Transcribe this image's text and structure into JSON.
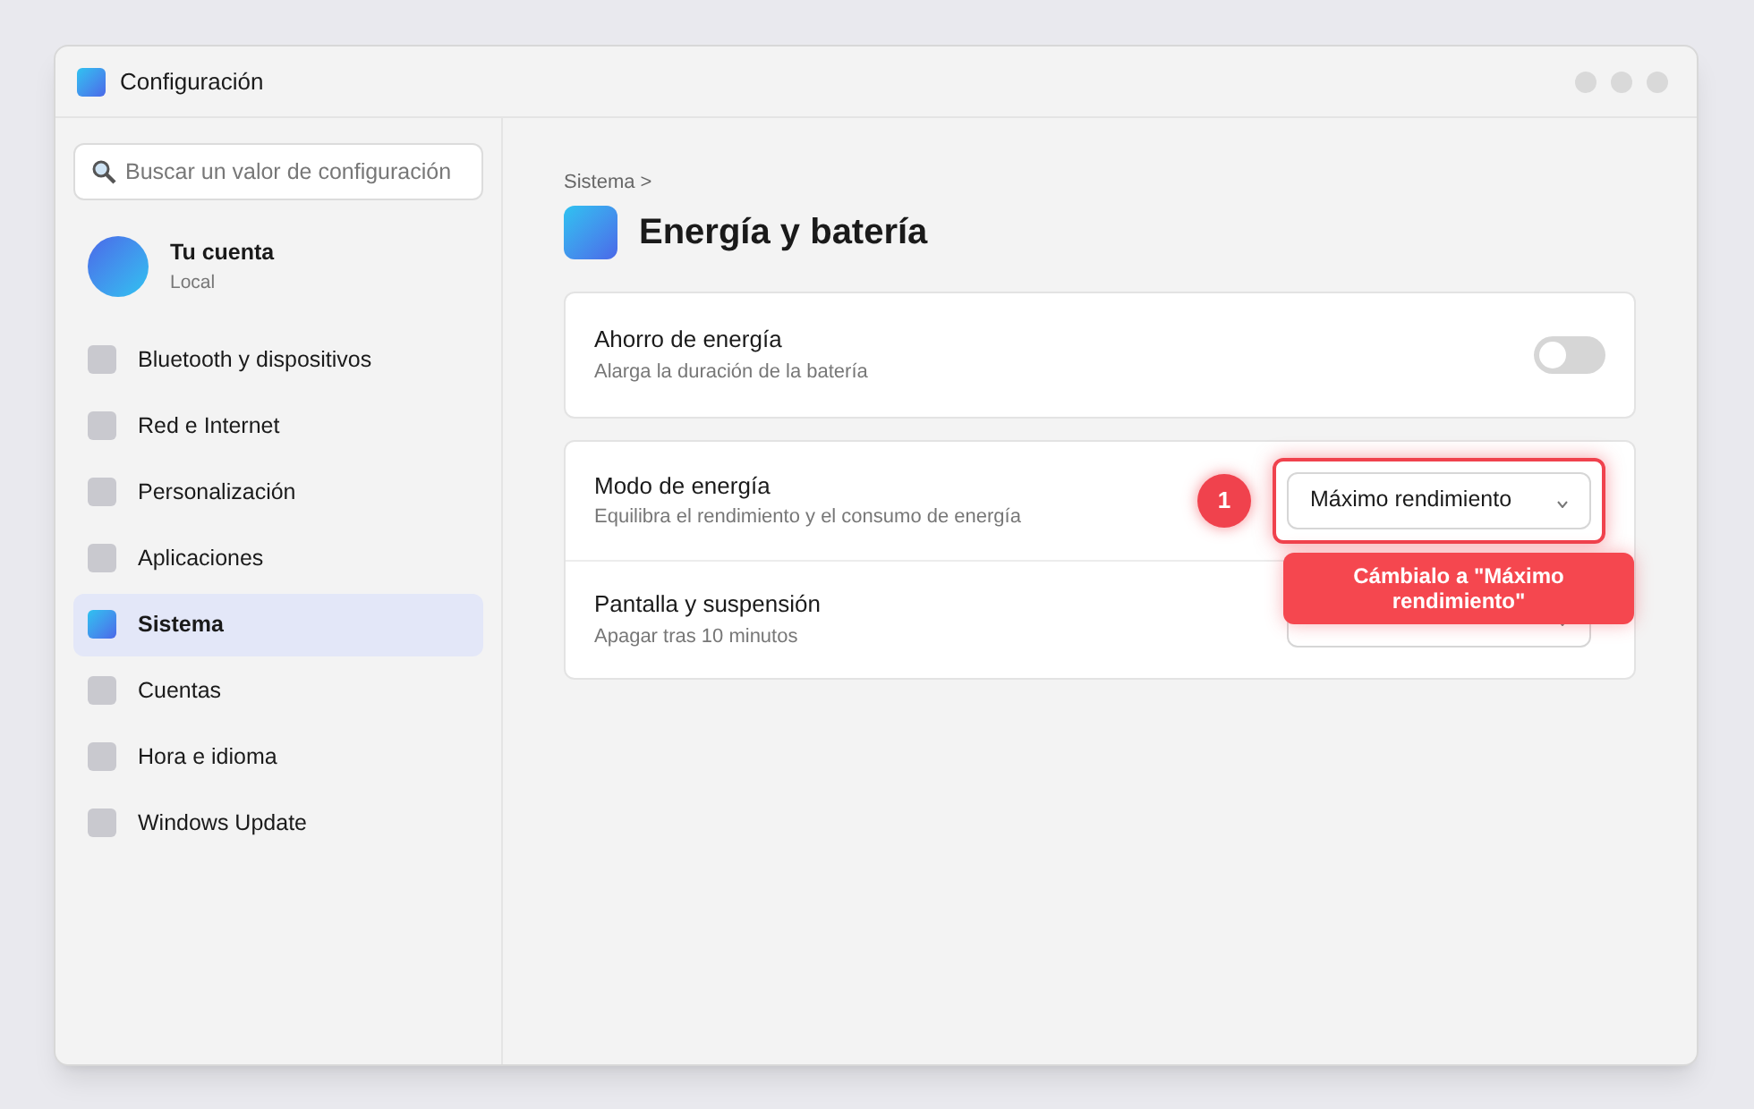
{
  "window": {
    "title": "Configuración"
  },
  "search": {
    "placeholder": "Buscar un valor de configuración"
  },
  "account": {
    "name": "Tu cuenta",
    "type": "Local"
  },
  "sidebar": {
    "items": [
      {
        "label": "Bluetooth y dispositivos",
        "selected": false
      },
      {
        "label": "Red e Internet",
        "selected": false
      },
      {
        "label": "Personalización",
        "selected": false
      },
      {
        "label": "Aplicaciones",
        "selected": false
      },
      {
        "label": "Sistema",
        "selected": true
      },
      {
        "label": "Cuentas",
        "selected": false
      },
      {
        "label": "Hora e idioma",
        "selected": false
      },
      {
        "label": "Windows Update",
        "selected": false
      }
    ]
  },
  "breadcrumb": "Sistema >",
  "page_title": "Energía y batería",
  "saver": {
    "title": "Ahorro de energía",
    "subtitle": "Alarga la duración de la batería",
    "on": false
  },
  "rows": [
    {
      "title": "Modo de energía",
      "subtitle": "Equilibra el rendimiento y el consumo de energía",
      "value": "Máximo rendimiento",
      "highlighted": true
    },
    {
      "title": "Pantalla y suspensión",
      "subtitle": "Apagar tras 10 minutos",
      "highlighted": false
    }
  ],
  "callout": {
    "step": "1",
    "text": "Cámbialo a \"Máximo rendimiento\""
  }
}
